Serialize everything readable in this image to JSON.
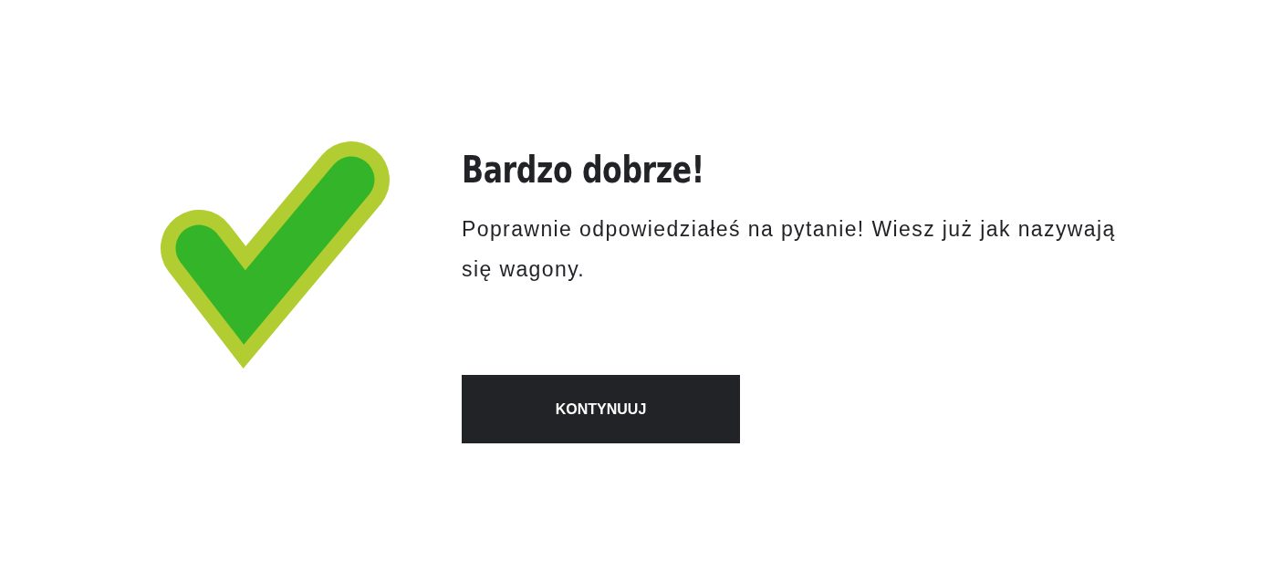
{
  "result": {
    "title": "Bardzo dobrze!",
    "message": "Poprawnie odpowiedziałeś na pytanie! Wiesz już jak nazywają się wagony."
  },
  "continue_button": {
    "label": "KONTYNUUJ"
  }
}
